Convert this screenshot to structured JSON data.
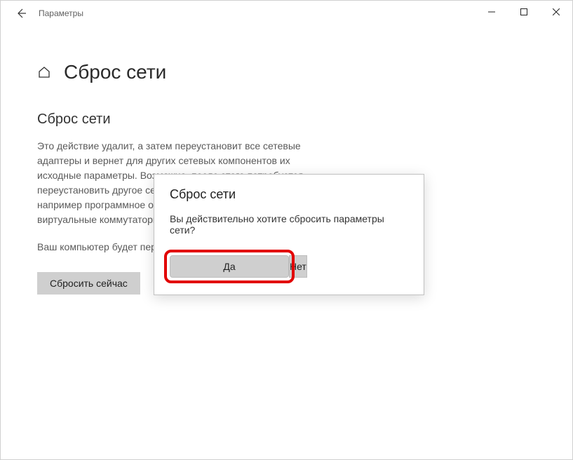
{
  "window": {
    "app_name": "Параметры"
  },
  "page": {
    "title": "Сброс сети",
    "section_title": "Сброс сети",
    "description": "Это действие удалит, а затем переустановит все сетевые адаптеры и вернет для других сетевых компонентов их исходные параметры. Возможно, после этого потребуется переустановить другое сетевое программное обеспечение, например программное обеспечение клиента VPN или виртуальные коммутаторы.",
    "restart_note": "Ваш компьютер будет перезагружен.",
    "reset_button_label": "Сбросить сейчас"
  },
  "dialog": {
    "title": "Сброс сети",
    "message": "Вы действительно хотите сбросить параметры сети?",
    "yes_label": "Да",
    "no_label": "Нет"
  }
}
